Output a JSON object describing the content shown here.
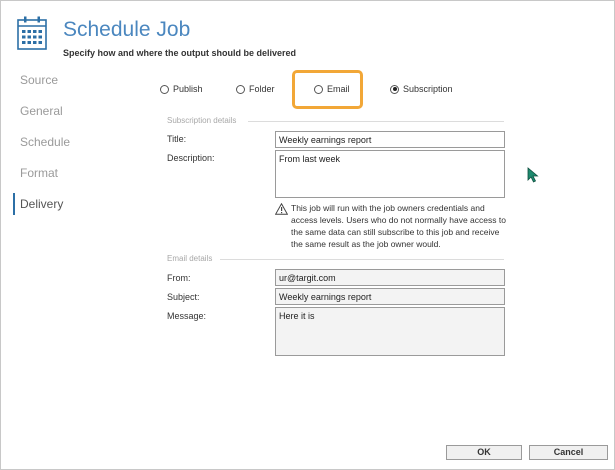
{
  "header": {
    "title": "Schedule Job",
    "subtitle": "Specify how and where the output should be delivered",
    "icon": "calendar-icon"
  },
  "sidebar": {
    "items": [
      {
        "label": "Source",
        "active": false
      },
      {
        "label": "General",
        "active": false
      },
      {
        "label": "Schedule",
        "active": false
      },
      {
        "label": "Format",
        "active": false
      },
      {
        "label": "Delivery",
        "active": true
      }
    ]
  },
  "delivery_options": {
    "publish": "Publish",
    "folder": "Folder",
    "email": "Email",
    "subscription": "Subscription",
    "selected": "Subscription"
  },
  "subscription": {
    "section_label": "Subscription details",
    "title_label": "Title:",
    "title_value": "Weekly earnings report",
    "description_label": "Description:",
    "description_value": "From last week",
    "warning": "This job will run with the job owners credentials and access levels. Users who do not normally have access to the same data can still subscribe to this job and receive the same result as the job owner would."
  },
  "email": {
    "section_label": "Email details",
    "from_label": "From:",
    "from_value": "ur@targit.com",
    "subject_label": "Subject:",
    "subject_value": "Weekly earnings report",
    "message_label": "Message:",
    "message_value": "Here it is"
  },
  "buttons": {
    "ok": "OK",
    "cancel": "Cancel"
  },
  "colors": {
    "title": "#4b87bf",
    "highlight": "#f2a737",
    "active_nav_bar": "#2c6fa6",
    "cursor": "#1e8a6e"
  }
}
